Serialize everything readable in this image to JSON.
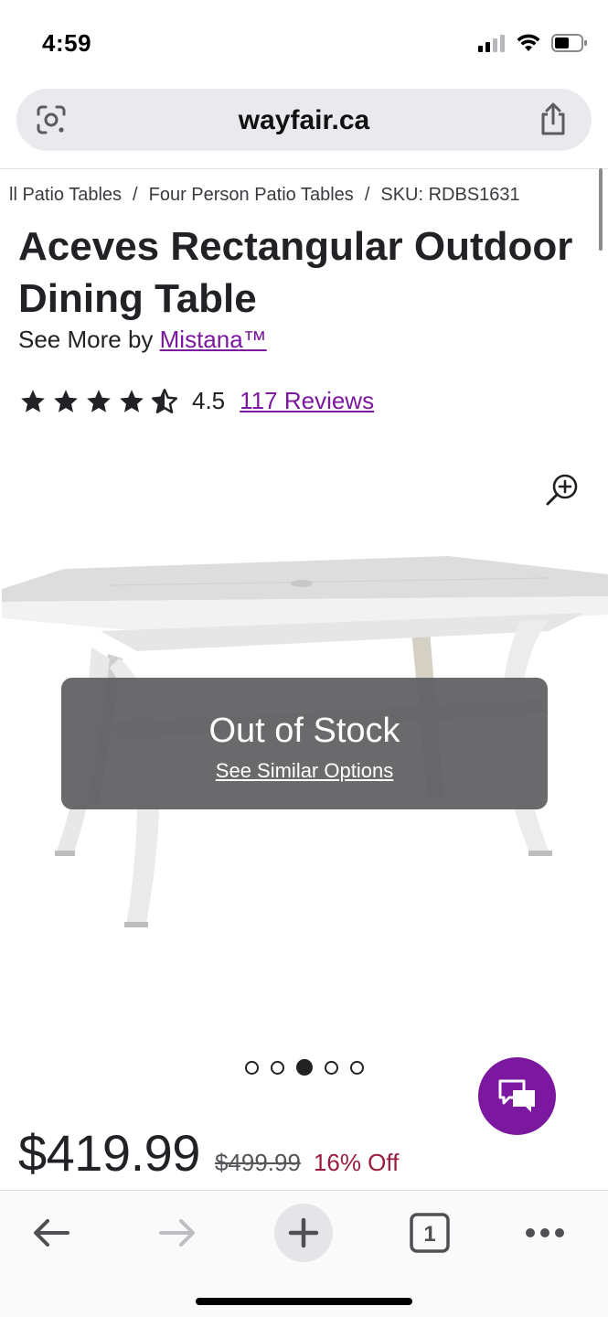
{
  "status_bar": {
    "time": "4:59"
  },
  "browser": {
    "url": "wayfair.ca"
  },
  "breadcrumb": {
    "items": [
      "ll Patio Tables",
      "Four Person Patio Tables",
      "SKU: RDBS1631"
    ],
    "separator": "/"
  },
  "product": {
    "title": "Aceves Rectangular Outdoor Dining Table",
    "see_more_prefix": "See More by",
    "brand": "Mistana™",
    "rating": 4.5,
    "rating_label": "4.5",
    "reviews_label": "117 Reviews",
    "stock_status": "Out of Stock",
    "similar_link": "See Similar Options",
    "image_count": 5,
    "active_image_index": 2,
    "price": "$419.99",
    "original_price": "$499.99",
    "discount": "16% Off"
  },
  "toolbar": {
    "tab_count": "1"
  },
  "colors": {
    "brand_purple": "#7b189f",
    "discount_red": "#9a1c3e",
    "overlay_gray": "#5f5f62"
  },
  "icons": {
    "lens": "google-lens-icon",
    "share": "share-icon",
    "zoom": "zoom-in-icon",
    "chat": "chat-icon",
    "back": "back-arrow-icon",
    "forward": "forward-arrow-icon",
    "new_tab": "plus-icon",
    "tabs": "tabs-icon",
    "more": "more-icon"
  }
}
